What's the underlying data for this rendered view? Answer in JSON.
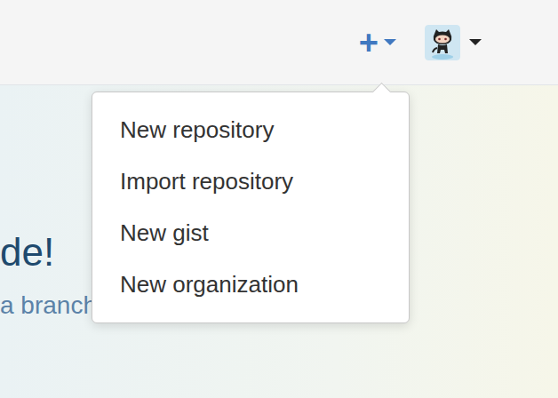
{
  "header": {
    "create_button": {
      "label": "+",
      "expanded": true
    }
  },
  "menu": {
    "items": [
      {
        "label": "New repository"
      },
      {
        "label": "Import repository"
      },
      {
        "label": "New gist"
      },
      {
        "label": "New organization"
      }
    ]
  },
  "hero": {
    "title": "de!",
    "subtitle": "a branch,"
  }
}
